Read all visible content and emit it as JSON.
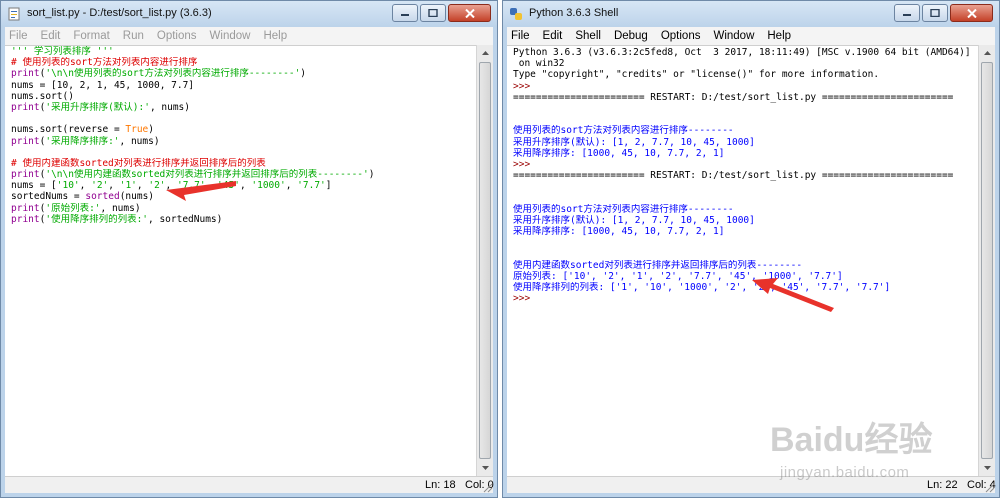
{
  "editor": {
    "title": "sort_list.py - D:/test/sort_list.py (3.6.3)",
    "menu": [
      "File",
      "Edit",
      "Format",
      "Run",
      "Options",
      "Window",
      "Help"
    ],
    "lines": [
      [
        [
          "''' 学习列表排序 '''",
          "string"
        ]
      ],
      [
        [
          "# 使用列表的sort方法对列表内容进行排序",
          "comment"
        ]
      ],
      [
        [
          "print",
          "builtin"
        ],
        [
          "(",
          "plain"
        ],
        [
          "'\\n\\n使用列表的sort方法对列表内容进行排序--------'",
          "string"
        ],
        [
          ")",
          "plain"
        ]
      ],
      [
        [
          "nums = [10, 2, 1, 45, 1000, 7.7]",
          "plain"
        ]
      ],
      [
        [
          "nums.sort()",
          "plain"
        ]
      ],
      [
        [
          "print",
          "builtin"
        ],
        [
          "(",
          "plain"
        ],
        [
          "'采用升序排序(默认):'",
          "string"
        ],
        [
          ", nums)",
          "plain"
        ]
      ],
      [
        [
          "",
          "plain"
        ]
      ],
      [
        [
          "nums.sort(reverse = ",
          "plain"
        ],
        [
          "True",
          "keyword"
        ],
        [
          ")",
          "plain"
        ]
      ],
      [
        [
          "print",
          "builtin"
        ],
        [
          "(",
          "plain"
        ],
        [
          "'采用降序排序:'",
          "string"
        ],
        [
          ", nums)",
          "plain"
        ]
      ],
      [
        [
          "",
          "plain"
        ]
      ],
      [
        [
          "# 使用内建函数sorted对列表进行排序并返回排序后的列表",
          "comment"
        ]
      ],
      [
        [
          "print",
          "builtin"
        ],
        [
          "(",
          "plain"
        ],
        [
          "'\\n\\n使用内建函数sorted对列表进行排序并返回排序后的列表--------'",
          "string"
        ],
        [
          ")",
          "plain"
        ]
      ],
      [
        [
          "nums = [",
          "plain"
        ],
        [
          "'10'",
          "string"
        ],
        [
          ", ",
          "plain"
        ],
        [
          "'2'",
          "string"
        ],
        [
          ", ",
          "plain"
        ],
        [
          "'1'",
          "string"
        ],
        [
          ", ",
          "plain"
        ],
        [
          "'2'",
          "string"
        ],
        [
          ", ",
          "plain"
        ],
        [
          "'7.7'",
          "string"
        ],
        [
          ", ",
          "plain"
        ],
        [
          "'45'",
          "string"
        ],
        [
          ", ",
          "plain"
        ],
        [
          "'1000'",
          "string"
        ],
        [
          ", ",
          "plain"
        ],
        [
          "'7.7'",
          "string"
        ],
        [
          "]",
          "plain"
        ]
      ],
      [
        [
          "sortedNums = ",
          "plain"
        ],
        [
          "sorted",
          "builtin"
        ],
        [
          "(nums)",
          "plain"
        ]
      ],
      [
        [
          "print",
          "builtin"
        ],
        [
          "(",
          "plain"
        ],
        [
          "'原始列表:'",
          "string"
        ],
        [
          ", nums)",
          "plain"
        ]
      ],
      [
        [
          "print",
          "builtin"
        ],
        [
          "(",
          "plain"
        ],
        [
          "'使用降序排列的列表:'",
          "string"
        ],
        [
          ", sortedNums)",
          "plain"
        ]
      ]
    ],
    "status_ln": "Ln: 18",
    "status_col": "Col: 0"
  },
  "shell": {
    "title": "Python 3.6.3 Shell",
    "menu": [
      "File",
      "Edit",
      "Shell",
      "Debug",
      "Options",
      "Window",
      "Help"
    ],
    "lines": [
      [
        [
          "Python 3.6.3 (v3.6.3:2c5fed8, Oct  3 2017, 18:11:49) [MSC v.1900 64 bit (AMD64)]",
          "plain"
        ]
      ],
      [
        [
          " on win32",
          "plain"
        ]
      ],
      [
        [
          "Type \"copyright\", \"credits\" or \"license()\" for more information.",
          "plain"
        ]
      ],
      [
        [
          ">>> ",
          "prompt"
        ]
      ],
      [
        [
          "======================= RESTART: D:/test/sort_list.py =======================",
          "plain"
        ]
      ],
      [
        [
          "",
          "plain"
        ]
      ],
      [
        [
          "",
          "plain"
        ]
      ],
      [
        [
          "使用列表的sort方法对列表内容进行排序--------",
          "output"
        ]
      ],
      [
        [
          "采用升序排序(默认): [1, 2, 7.7, 10, 45, 1000]",
          "output"
        ]
      ],
      [
        [
          "采用降序排序: [1000, 45, 10, 7.7, 2, 1]",
          "output"
        ]
      ],
      [
        [
          ">>> ",
          "prompt"
        ]
      ],
      [
        [
          "======================= RESTART: D:/test/sort_list.py =======================",
          "plain"
        ]
      ],
      [
        [
          "",
          "plain"
        ]
      ],
      [
        [
          "",
          "plain"
        ]
      ],
      [
        [
          "使用列表的sort方法对列表内容进行排序--------",
          "output"
        ]
      ],
      [
        [
          "采用升序排序(默认): [1, 2, 7.7, 10, 45, 1000]",
          "output"
        ]
      ],
      [
        [
          "采用降序排序: [1000, 45, 10, 7.7, 2, 1]",
          "output"
        ]
      ],
      [
        [
          "",
          "plain"
        ]
      ],
      [
        [
          "",
          "plain"
        ]
      ],
      [
        [
          "使用内建函数sorted对列表进行排序并返回排序后的列表--------",
          "output"
        ]
      ],
      [
        [
          "原始列表: ['10', '2', '1', '2', '7.7', '45', '1000', '7.7']",
          "output"
        ]
      ],
      [
        [
          "使用降序排列的列表: ['1', '10', '1000', '2', '2', '45', '7.7', '7.7']",
          "output"
        ]
      ],
      [
        [
          ">>> ",
          "prompt"
        ]
      ]
    ],
    "status_ln": "Ln: 22",
    "status_col": "Col: 4"
  },
  "watermark": {
    "logo": "Baidu经验",
    "url": "jingyan.baidu.com"
  },
  "colors": {
    "plain": "#000000",
    "string": "#00aa00",
    "comment": "#dd0000",
    "builtin": "#900090",
    "keyword": "#ff7700",
    "output": "#0000ff",
    "prompt": "#990000",
    "annotation_arrow": "#e8322b"
  }
}
